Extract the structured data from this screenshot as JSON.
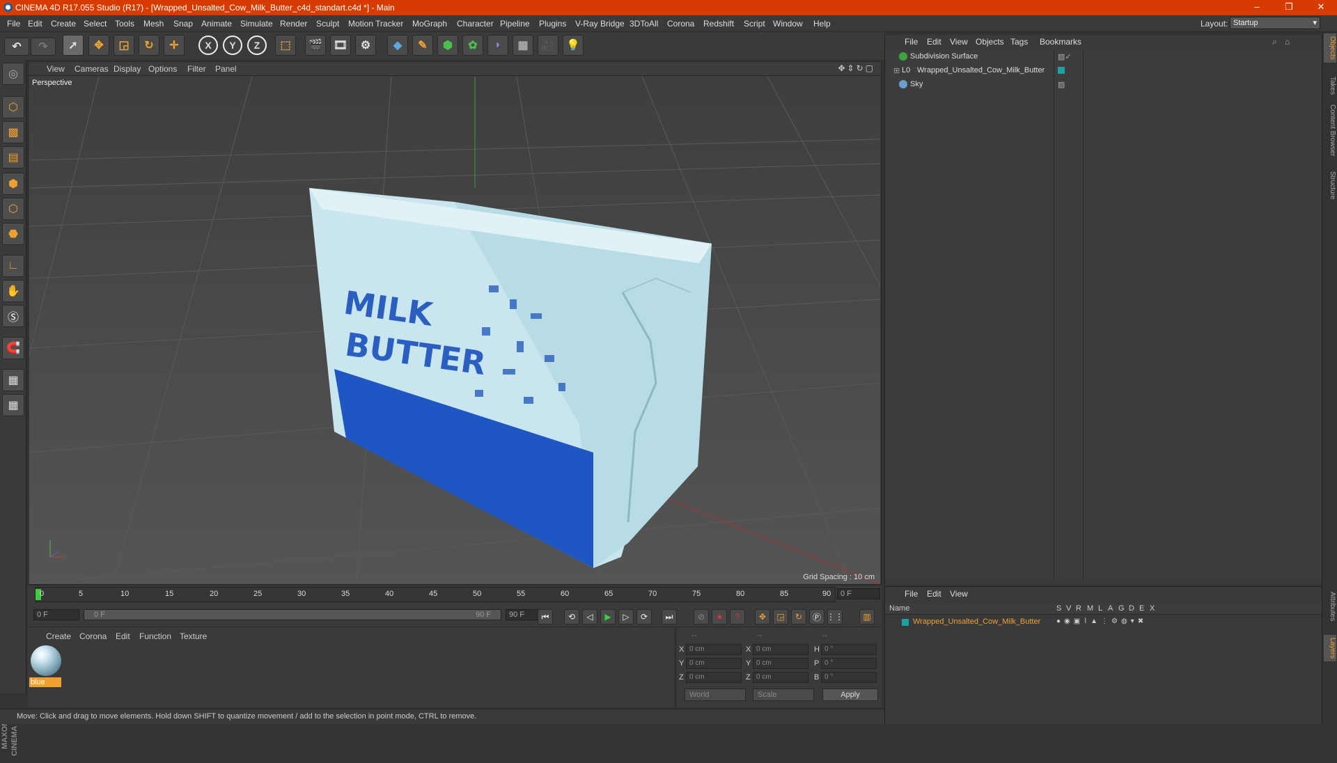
{
  "titlebar": {
    "title": "CINEMA 4D R17.055 Studio (R17) - [Wrapped_Unsalted_Cow_Milk_Butter_c4d_standart.c4d *] - Main",
    "minimize": "–",
    "maximize": "❐",
    "close": "✕"
  },
  "menu": {
    "items": [
      "File",
      "Edit",
      "Create",
      "Select",
      "Tools",
      "Mesh",
      "Snap",
      "Animate",
      "Simulate",
      "Render",
      "Sculpt",
      "Motion Tracker",
      "MoGraph",
      "Character",
      "Pipeline",
      "Plugins",
      "V-Ray Bridge",
      "3DToAll",
      "Corona",
      "Redshift",
      "Script",
      "Window",
      "Help"
    ],
    "layout_label": "Layout:",
    "layout_value": "Startup"
  },
  "toolbar": {
    "axis_x": "X",
    "axis_y": "Y",
    "axis_z": "Z"
  },
  "viewport": {
    "menu": [
      "View",
      "Cameras",
      "Display",
      "Options",
      "Filter",
      "Panel"
    ],
    "label": "Perspective",
    "grid_spacing": "Grid Spacing : 10 cm",
    "object_text_1": "MILK",
    "object_text_2": "BUTTER"
  },
  "timeline": {
    "ticks": [
      "0",
      "5",
      "10",
      "15",
      "20",
      "25",
      "30",
      "35",
      "40",
      "45",
      "50",
      "55",
      "60",
      "65",
      "70",
      "75",
      "80",
      "85",
      "90"
    ],
    "current_frame": "0 F",
    "start_field": "0 F",
    "range_start": "0 F",
    "range_end": "90 F",
    "end_field": "90 F"
  },
  "materials": {
    "menu": [
      "Create",
      "Corona",
      "Edit",
      "Function",
      "Texture"
    ],
    "material_name": "blue"
  },
  "coords": {
    "header": [
      "--",
      "--",
      "--"
    ],
    "rows": [
      {
        "l1": "X",
        "v1": "0 cm",
        "l2": "X",
        "v2": "0 cm",
        "l3": "H",
        "v3": "0 °"
      },
      {
        "l1": "Y",
        "v1": "0 cm",
        "l2": "Y",
        "v2": "0 cm",
        "l3": "P",
        "v3": "0 °"
      },
      {
        "l1": "Z",
        "v1": "0 cm",
        "l2": "Z",
        "v2": "0 cm",
        "l3": "B",
        "v3": "0 °"
      }
    ],
    "space": "World",
    "mode": "Scale",
    "apply": "Apply"
  },
  "status": "Move: Click and drag to move elements. Hold down SHIFT to quantize movement / add to the selection in point mode, CTRL to remove.",
  "objects": {
    "menu": [
      "File",
      "Edit",
      "View",
      "Objects",
      "Tags",
      "Bookmarks"
    ],
    "items": [
      {
        "name": "Subdivision Surface",
        "color": "#3aa63a"
      },
      {
        "name": "Wrapped_Unsalted_Cow_Milk_Butter",
        "color": "#cccccc"
      },
      {
        "name": "Sky",
        "color": "#6aa0d0"
      }
    ]
  },
  "layers": {
    "menu": [
      "File",
      "Edit",
      "View"
    ],
    "columns": [
      "Name",
      "S",
      "V",
      "R",
      "M",
      "L",
      "A",
      "G",
      "D",
      "E",
      "X"
    ],
    "row_name": "Wrapped_Unsalted_Cow_Milk_Butter",
    "row_color": "#19a3a3"
  },
  "side_tabs": [
    "Objects",
    "Takes",
    "Content Browser",
    "Structure",
    "Attributes",
    "Layers"
  ],
  "branding": "MAXON CINEMA 4D"
}
